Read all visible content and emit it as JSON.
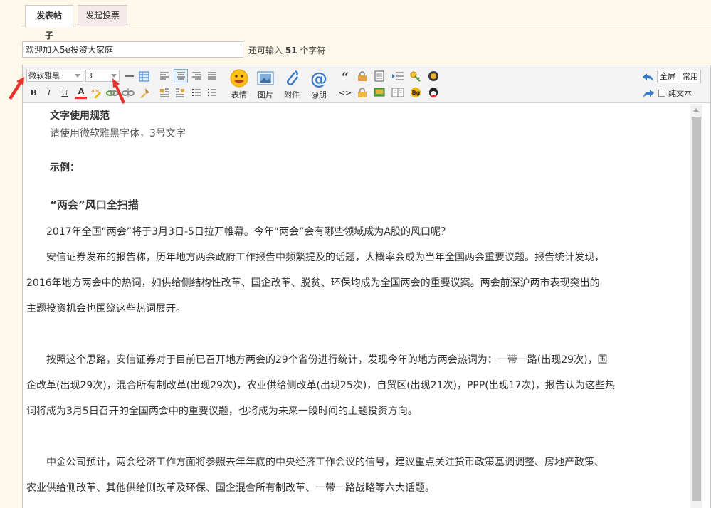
{
  "tabs": [
    {
      "label": "发表帖子",
      "active": true
    },
    {
      "label": "发起投票",
      "active": false
    }
  ],
  "subject": {
    "value": "欢迎加入5e投资大家庭"
  },
  "counter": {
    "prefix": "还可输入",
    "count": "51",
    "suffix": "个字符"
  },
  "toolbar": {
    "font_family": "微软雅黑",
    "font_size": "3",
    "bold": "B",
    "italic": "I",
    "underline": "U",
    "font_color": "A",
    "emoji_label": "表情",
    "image_label": "图片",
    "attachment_label": "附件",
    "mention_label": "@朋",
    "quote": "“",
    "code": "<>",
    "fullscreen": "全屏",
    "common": "常用",
    "plain_text": "纯文本"
  },
  "content": {
    "guide_title": "文字使用规范",
    "guide_text": "请使用微软雅黑字体，3号文字",
    "example_label": "示例：",
    "article_title": "“两会”风口全扫描",
    "paragraphs": [
      "2017年全国“两会”将于3月3日-5日拉开帷幕。今年“两会”会有哪些领域成为A股的风口呢？",
      "安信证券发布的报告称，历年地方两会政府工作报告中频繁提及的话题，大概率会成为当年全国两会重要议题。报告统计发现，",
      "2016年地方两会中的热词，如供给侧结构性改革、国企改革、脱贫、环保均成为全国两会的重要议案。两会前深沪两市表现突出的",
      "主题投资机会也围绕这些热词展开。",
      "按照这个思路，安信证券对于目前已召开地方两会的29个省份进行统计，发现今年的地方两会热词为：一带一路(出现29次)，国",
      "企改革(出现29次)，混合所有制改革(出现29次)，农业供给侧改革(出现25次)，自贸区(出现21次)，PPP(出现17次)，报告认为这些热",
      "词将成为3月5日召开的全国两会中的重要议题，也将成为未来一段时间的主题投资方向。",
      "中金公司预计，两会经济工作方面将参照去年年底的中央经济工作会议的信号，建议重点关注货币政策基调调整、房地产政策、",
      "农业供给侧改革、其他供给侧改革及环保、国企混合所有制改革、一带一路战略等六大话题。"
    ]
  },
  "colors": {
    "accent_red": "#e8322c",
    "toolbar_bg": "#f3f3f3",
    "page_bg": "#fdf8ea"
  }
}
